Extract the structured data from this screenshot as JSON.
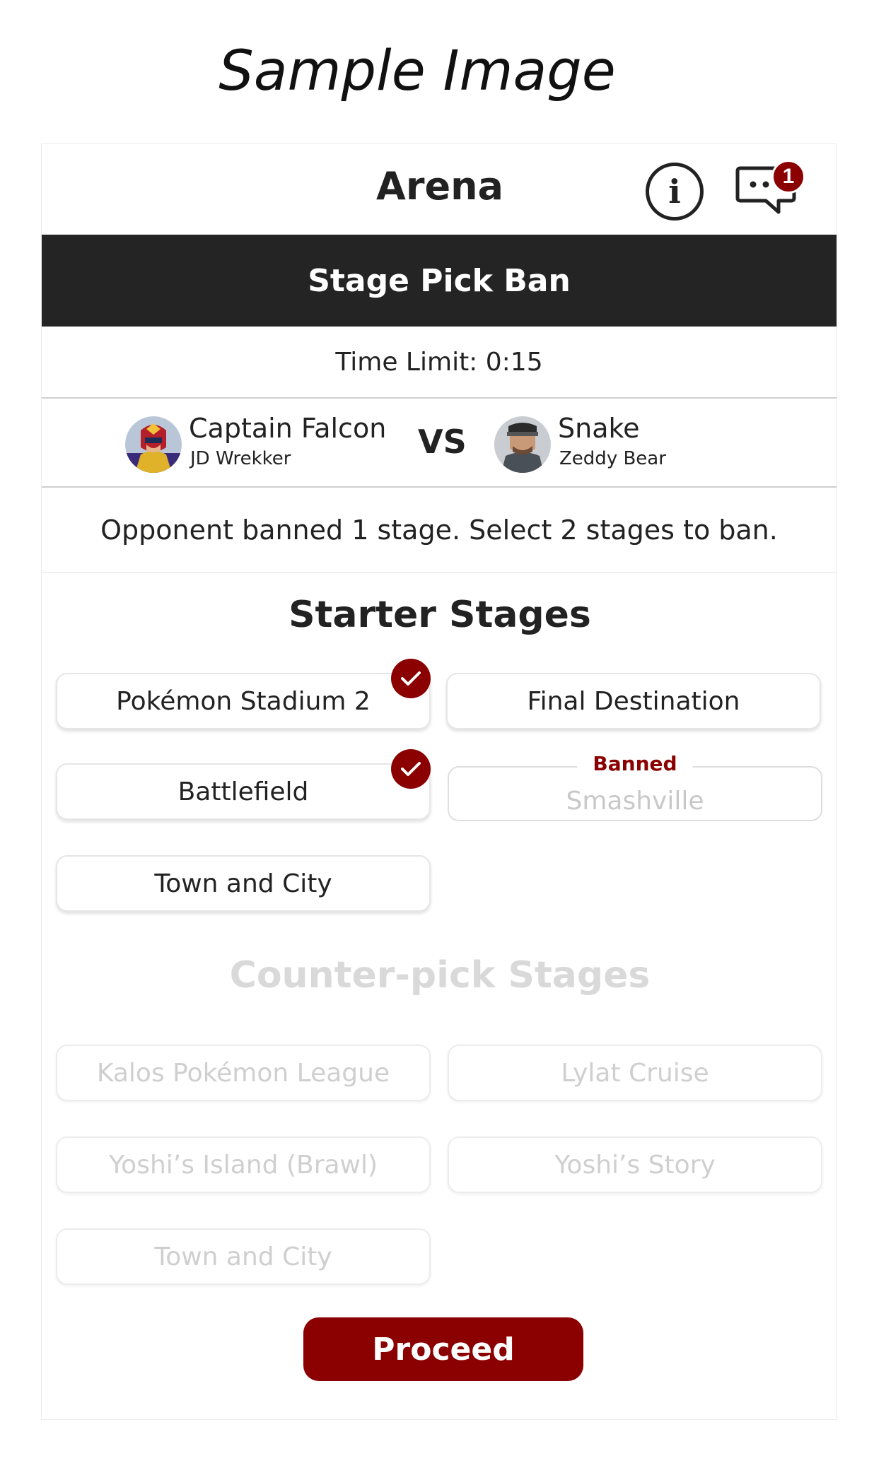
{
  "caption": "Sample Image",
  "header": {
    "title": "Arena",
    "info_icon": "info-icon",
    "chat_icon": "chat-icon",
    "chat_badge_count": "1"
  },
  "phase": {
    "title": "Stage Pick Ban"
  },
  "timer": {
    "label": "Time Limit: 0:15"
  },
  "matchup": {
    "player1": {
      "character": "Captain Falcon",
      "name": "JD Wrekker",
      "avatar_icon": "captain-falcon-avatar"
    },
    "vs_label": "VS",
    "player2": {
      "character": "Snake",
      "name": "Zeddy Bear",
      "avatar_icon": "snake-avatar"
    }
  },
  "instruction": "Opponent banned 1 stage. Select 2 stages to ban.",
  "starter": {
    "title": "Starter Stages",
    "stages": [
      {
        "label": "Pokémon Stadium 2",
        "state": "selected"
      },
      {
        "label": "Final Destination",
        "state": "available"
      },
      {
        "label": "Battlefield",
        "state": "selected"
      },
      {
        "label": "Smashville",
        "state": "banned",
        "banned_label": "Banned"
      },
      {
        "label": "Town and City",
        "state": "available"
      }
    ]
  },
  "counterpick": {
    "title": "Counter-pick Stages",
    "stages": [
      {
        "label": "Kalos Pokémon League",
        "state": "disabled"
      },
      {
        "label": "Lylat Cruise",
        "state": "disabled"
      },
      {
        "label": "Yoshi’s Island (Brawl)",
        "state": "disabled"
      },
      {
        "label": "Yoshi’s Story",
        "state": "disabled"
      },
      {
        "label": "Town and City",
        "state": "disabled"
      }
    ]
  },
  "proceed_label": "Proceed",
  "colors": {
    "accent": "#8b0000",
    "dark_bar": "#242424",
    "disabled_text": "#cfcfcf"
  }
}
